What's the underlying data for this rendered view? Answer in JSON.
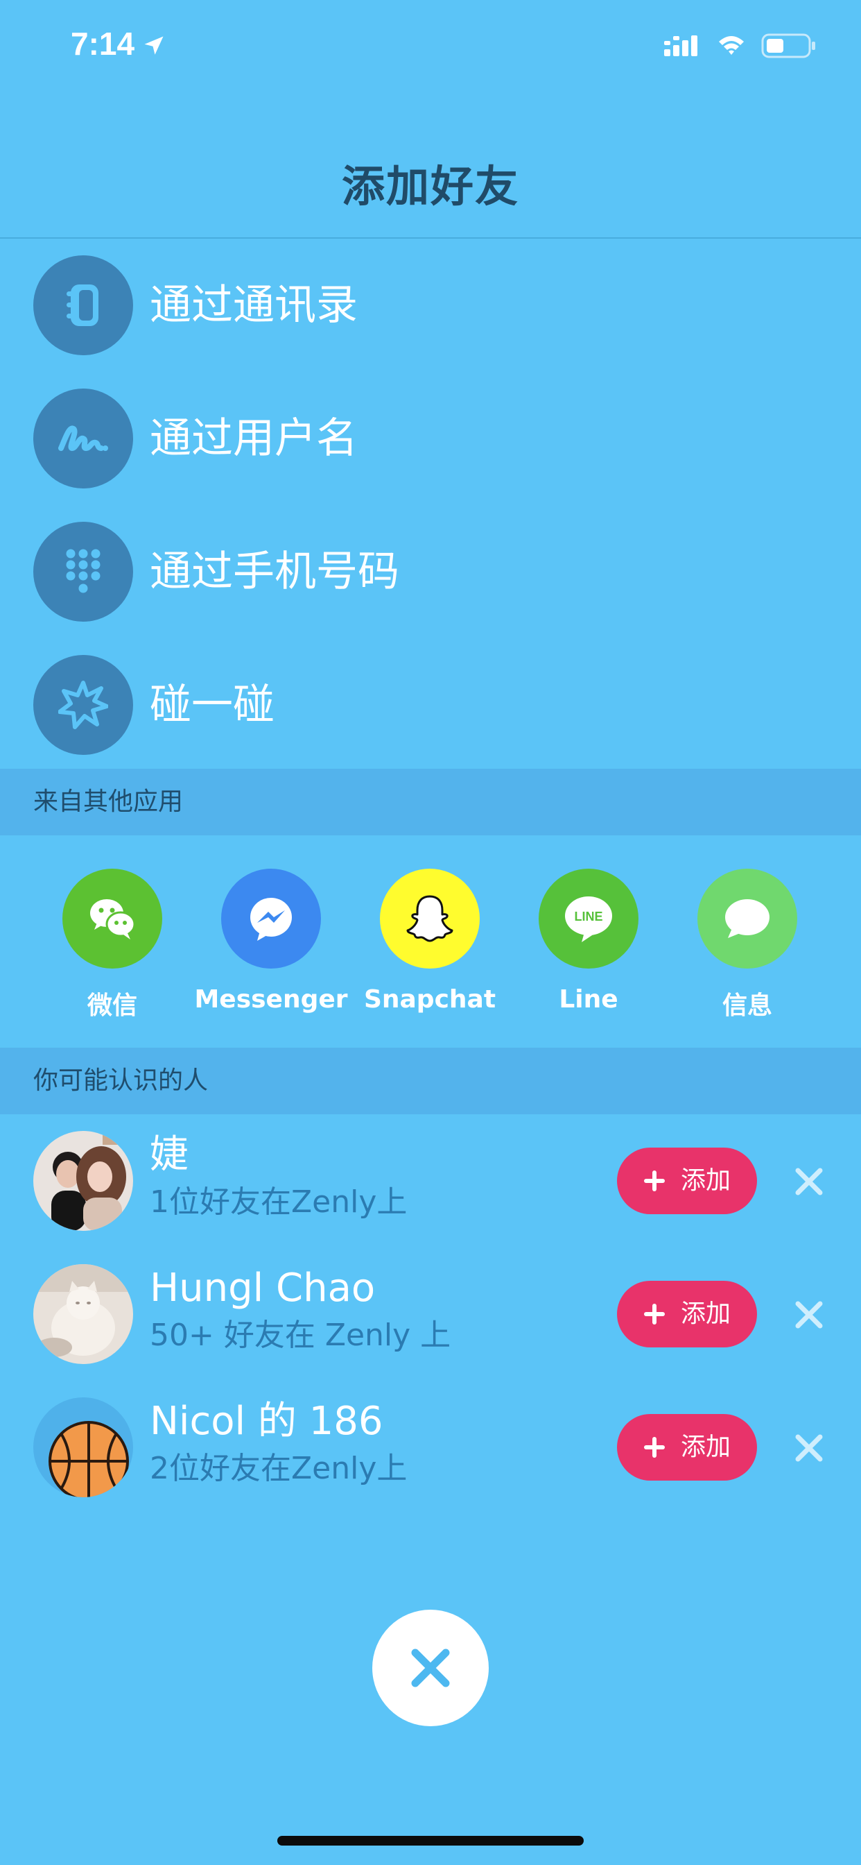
{
  "status_bar": {
    "time": "7:14",
    "icons": [
      "location-arrow-icon",
      "cellular-signal-icon",
      "wifi-icon",
      "battery-icon"
    ]
  },
  "header": {
    "title": "添加好友"
  },
  "methods": [
    {
      "label": "通过通讯录",
      "icon": "contacts-book-icon"
    },
    {
      "label": "通过用户名",
      "icon": "signature-icon"
    },
    {
      "label": "通过手机号码",
      "icon": "dialpad-icon"
    },
    {
      "label": "碰一碰",
      "icon": "bump-burst-icon"
    }
  ],
  "other_apps": {
    "title": "来自其他应用",
    "apps": [
      {
        "label": "微信",
        "icon": "wechat-icon",
        "color": "#5cc132"
      },
      {
        "label": "Messenger",
        "icon": "messenger-icon",
        "color": "#3c89f0"
      },
      {
        "label": "Snapchat",
        "icon": "snapchat-ghost-icon",
        "color": "#fffc2e"
      },
      {
        "label": "Line",
        "icon": "line-icon",
        "color": "#56c13a"
      },
      {
        "label": "信息",
        "icon": "messages-bubble-icon",
        "color": "#70d86e"
      }
    ]
  },
  "suggestions": {
    "title": "你可能认识的人",
    "add_label": "添加",
    "people": [
      {
        "name": "婕",
        "subtitle": "1位好友在Zenly上",
        "avatar": "couple-photo-avatar"
      },
      {
        "name": "Hungl Chao",
        "subtitle": "50+ 好友在 Zenly 上",
        "avatar": "cat-photo-avatar"
      },
      {
        "name": "Nicol 的 186",
        "subtitle": "2位好友在Zenly上",
        "avatar": "basketball-avatar"
      }
    ]
  },
  "colors": {
    "background": "#5bc4f7",
    "section_header": "#53b3ec",
    "method_circle": "#3c83b6",
    "add_button": "#e8336a",
    "title_text": "#204b68",
    "subtitle_text": "#2b7bb1"
  }
}
